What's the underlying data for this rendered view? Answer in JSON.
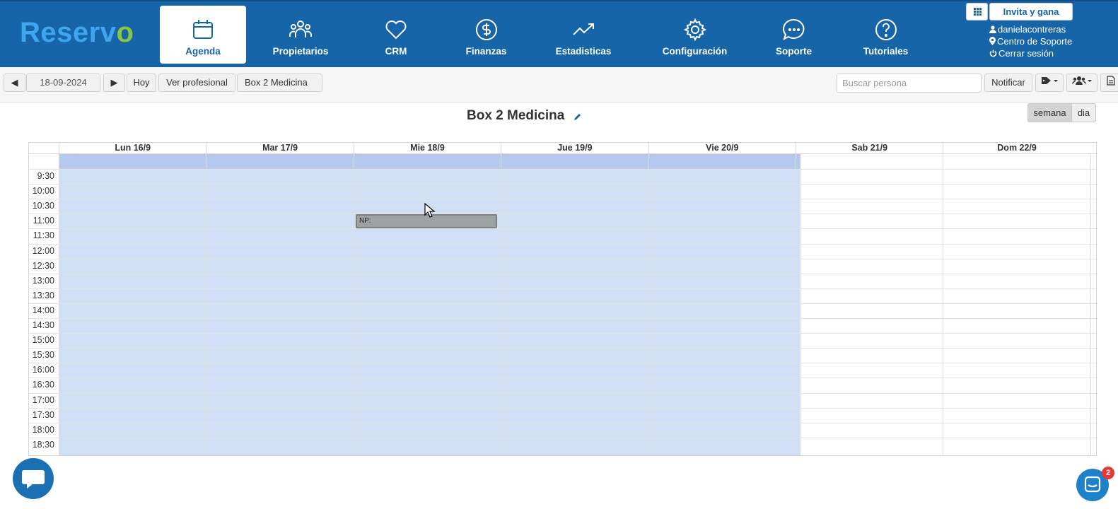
{
  "brand": {
    "name": "Reserv",
    "check_char": "o"
  },
  "nav": {
    "items": [
      {
        "label": "Agenda",
        "icon": "calendar-icon",
        "active": true
      },
      {
        "label": "Propietarios",
        "icon": "users-icon"
      },
      {
        "label": "CRM",
        "icon": "heart-icon"
      },
      {
        "label": "Finanzas",
        "icon": "dollar-icon"
      },
      {
        "label": "Estadisticas",
        "icon": "trend-icon"
      },
      {
        "label": "Configuración",
        "icon": "gear-icon"
      },
      {
        "label": "Soporte",
        "icon": "chat-icon"
      },
      {
        "label": "Tutoriales",
        "icon": "help-icon"
      }
    ]
  },
  "header_right": {
    "invite_label": "Invita y gana",
    "username": "danielacontreras",
    "support_link": "Centro de Soporte",
    "logout_link": "Cerrar sesión"
  },
  "toolbar": {
    "prev_label": "◀",
    "date_value": "18-09-2024",
    "next_label": "▶",
    "today_label": "Hoy",
    "professional_label": "Ver profesional",
    "resource_label": "Box 2 Medicina",
    "search_placeholder": "Buscar persona",
    "notify_label": "Notificar"
  },
  "calendar": {
    "title": "Box 2 Medicina",
    "view_week": "semana",
    "view_day": "dia",
    "days": [
      "Lun 16/9",
      "Mar 17/9",
      "Mie 18/9",
      "Jue 19/9",
      "Vie 20/9",
      "Sab 21/9",
      "Dom 22/9"
    ],
    "times": [
      "9:30",
      "10:00",
      "10:30",
      "11:00",
      "11:30",
      "12:00",
      "12:30",
      "13:00",
      "13:30",
      "14:00",
      "14:30",
      "15:00",
      "15:30",
      "16:00",
      "16:30",
      "17:00",
      "17:30",
      "18:00",
      "18:30"
    ],
    "event": {
      "label": "NP:",
      "day": "Mie 18/9",
      "time": "11:00"
    }
  },
  "chat": {
    "badge_count": "2"
  },
  "colors": {
    "brand_blue": "#1565a8",
    "working_hours": "#bfd2f0",
    "event_gray": "#9ea2a3"
  }
}
